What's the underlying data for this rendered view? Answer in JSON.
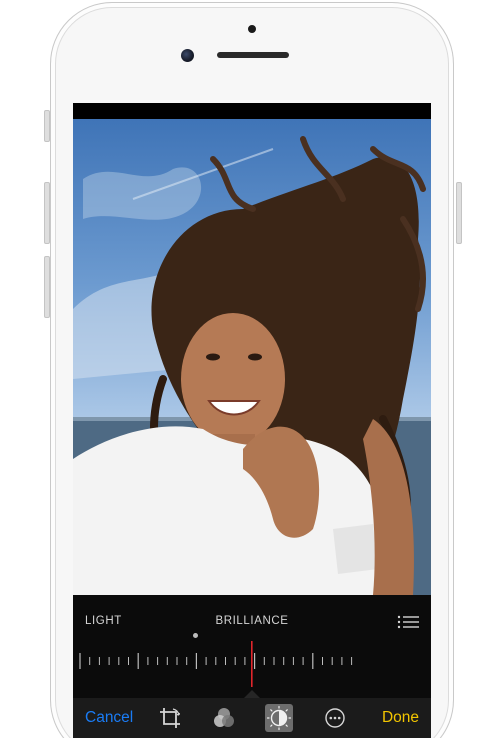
{
  "adjustment": {
    "section_label": "LIGHT",
    "active_label": "BRILLIANCE"
  },
  "toolbar": {
    "cancel_label": "Cancel",
    "done_label": "Done"
  },
  "icons": {
    "list": "list-icon",
    "crop": "crop-icon",
    "filters": "filters-icon",
    "adjust": "adjust-icon",
    "more": "more-icon"
  },
  "colors": {
    "cancel": "#1a7cf5",
    "done": "#f2c500",
    "scrubber_indicator": "#e0262b"
  }
}
